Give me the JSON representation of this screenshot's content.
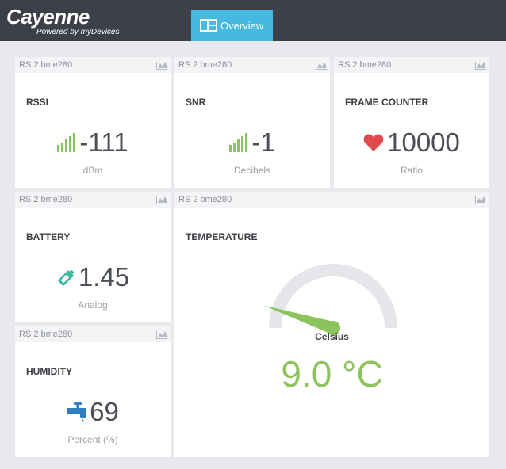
{
  "app": {
    "logo": "Cayenne",
    "logo_sub": "Powered by myDevices",
    "tab_overview": "Overview"
  },
  "colors": {
    "topbar": "#3d4048",
    "tab_active": "#45b9e0",
    "signal_green": "#8dc35d",
    "heart_red": "#e04a4f",
    "battery_teal": "#3fb8a3",
    "tap_blue": "#2d7fc1",
    "gauge_track": "#e4e6e9",
    "gauge_needle": "#8dc35d"
  },
  "widgets": {
    "rssi": {
      "device": "RS 2 bme280",
      "title": "RSSI",
      "value": "-111",
      "unit": "dBm",
      "icon": "signal-bars-icon"
    },
    "snr": {
      "device": "RS 2 bme280",
      "title": "SNR",
      "value": "-1",
      "unit": "Decibels",
      "icon": "signal-bars-icon"
    },
    "frame_counter": {
      "device": "RS 2 bme280",
      "title": "FRAME COUNTER",
      "value": "10000",
      "unit": "Ratio",
      "icon": "heart-icon"
    },
    "battery": {
      "device": "RS 2 bme280",
      "title": "BATTERY",
      "value": "1.45",
      "unit": "Analog",
      "icon": "battery-icon"
    },
    "humidity": {
      "device": "RS 2 bme280",
      "title": "HUMIDITY",
      "value": "69",
      "unit": "Percent (%)",
      "icon": "water-tap-icon"
    },
    "temperature": {
      "device": "RS 2 bme280",
      "title": "TEMPERATURE",
      "label": "Celsius",
      "value": "9.0 °C",
      "gauge_fraction": 0.1,
      "icon": "gauge-icon"
    }
  }
}
